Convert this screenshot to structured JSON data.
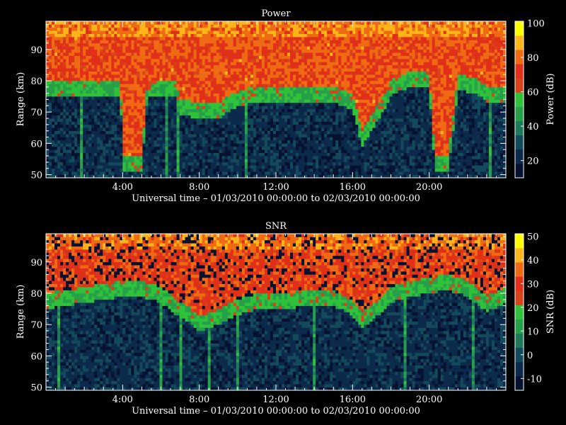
{
  "colors": {
    "background": "#000000",
    "frame": "#ffffff",
    "colormap": [
      "#061231",
      "#0c2a4c",
      "#134a5c",
      "#1f7a5c",
      "#27a04a",
      "#2fc23a",
      "#d8441a",
      "#e0301a",
      "#f06a14",
      "#ffb41a",
      "#ffff00"
    ]
  },
  "chart_data": [
    {
      "type": "heatmap",
      "title": "Power",
      "xlabel": "Universal time – 01/03/2010 00:00:00 to 02/03/2010 00:00:00",
      "ylabel": "Range (km)",
      "xlim": [
        0,
        24
      ],
      "ylim": [
        49,
        99
      ],
      "xticks": [
        4,
        8,
        12,
        16,
        20
      ],
      "xtick_labels": [
        "4:00",
        "8:00",
        "12:00",
        "16:00",
        "20:00"
      ],
      "yticks": [
        50,
        60,
        70,
        80,
        90
      ],
      "ytick_labels": [
        "50",
        "60",
        "70",
        "80",
        "90"
      ],
      "colorbar": {
        "label": "Power (dB)",
        "range": [
          10,
          101
        ],
        "ticks": [
          20,
          40,
          60,
          80,
          100
        ],
        "tick_labels": [
          "20",
          "40",
          "60",
          "80",
          "100"
        ]
      },
      "bottom_range_km": [
        [
          0,
          76
        ],
        [
          1,
          76
        ],
        [
          2,
          76
        ],
        [
          3,
          76
        ],
        [
          3.9,
          76
        ],
        [
          4.0,
          52
        ],
        [
          5.0,
          52
        ],
        [
          5.3,
          76
        ],
        [
          6.8,
          76
        ],
        [
          7.0,
          70
        ],
        [
          8,
          69
        ],
        [
          9,
          69
        ],
        [
          10,
          73
        ],
        [
          11,
          74
        ],
        [
          12,
          74
        ],
        [
          13,
          74
        ],
        [
          14,
          74
        ],
        [
          15,
          74
        ],
        [
          16,
          72
        ],
        [
          16.5,
          60
        ],
        [
          17.5,
          70
        ],
        [
          18.1,
          77
        ],
        [
          19,
          79
        ],
        [
          20,
          79
        ],
        [
          20.3,
          52
        ],
        [
          21.0,
          52
        ],
        [
          21.5,
          78
        ],
        [
          22.5,
          77
        ],
        [
          23,
          74
        ],
        [
          24,
          74
        ]
      ]
    },
    {
      "type": "heatmap",
      "title": "SNR",
      "xlabel": "Universal time – 01/03/2010 00:00:00 to 02/03/2010 00:00:00",
      "ylabel": "Range (km)",
      "xlim": [
        0,
        24
      ],
      "ylim": [
        49,
        99
      ],
      "xticks": [
        4,
        8,
        12,
        16,
        20
      ],
      "xtick_labels": [
        "4:00",
        "8:00",
        "12:00",
        "16:00",
        "20:00"
      ],
      "yticks": [
        50,
        60,
        70,
        80,
        90
      ],
      "ytick_labels": [
        "50",
        "60",
        "70",
        "80",
        "90"
      ],
      "colorbar": {
        "label": "SNR (dB)",
        "range": [
          -15,
          51
        ],
        "ticks": [
          -10,
          0,
          10,
          20,
          30,
          40,
          50
        ],
        "tick_labels": [
          "-10",
          "0",
          "10",
          "20",
          "30",
          "40",
          "50"
        ]
      },
      "bottom_range_km": [
        [
          0,
          76
        ],
        [
          2,
          78
        ],
        [
          4,
          80
        ],
        [
          5,
          80
        ],
        [
          6,
          78
        ],
        [
          6.8,
          74
        ],
        [
          7.5,
          72
        ],
        [
          8,
          69
        ],
        [
          9,
          71
        ],
        [
          10,
          74
        ],
        [
          11,
          76
        ],
        [
          12,
          76
        ],
        [
          14,
          77
        ],
        [
          15,
          77
        ],
        [
          16,
          74
        ],
        [
          16.5,
          70
        ],
        [
          17,
          72
        ],
        [
          18,
          78
        ],
        [
          19,
          80
        ],
        [
          20,
          81
        ],
        [
          21,
          82
        ],
        [
          22,
          80
        ],
        [
          23,
          75
        ],
        [
          24,
          78
        ]
      ]
    }
  ]
}
